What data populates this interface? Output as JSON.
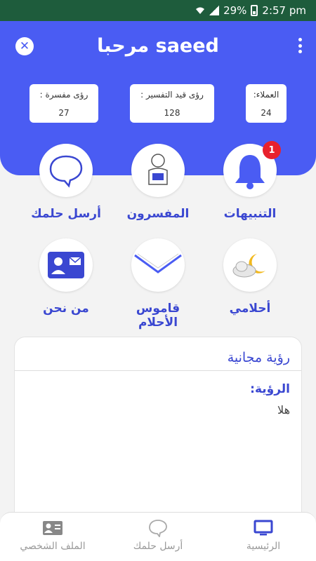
{
  "status_bar": {
    "battery": "29%",
    "time": "2:57 pm"
  },
  "header": {
    "title": "مرحبا saeed",
    "stats": [
      {
        "label": "رؤى مفسرة :",
        "value": "27"
      },
      {
        "label": "رؤى قيد التفسير :",
        "value": "128"
      },
      {
        "label": "العملاء:",
        "value": "24"
      }
    ]
  },
  "grid": {
    "send_dream": "أرسل حلمك",
    "interpreters": "المفسرون",
    "notifications": "التنبيهات",
    "notifications_badge": "1",
    "about_us": "من نحن",
    "dictionary": "قاموس الأحلام",
    "my_dreams": "أحلامي"
  },
  "card": {
    "title": "رؤية مجانية",
    "subtitle": "الرؤية:",
    "text": "هلا"
  },
  "bottom_nav": {
    "profile": "الملف الشخصي",
    "send": "أرسل حلمك",
    "home": "الرئيسية"
  },
  "colors": {
    "primary": "#4a5cf3",
    "accent": "#3a47d1",
    "badge": "#e8212c",
    "status_bar": "#1e5c3c"
  }
}
